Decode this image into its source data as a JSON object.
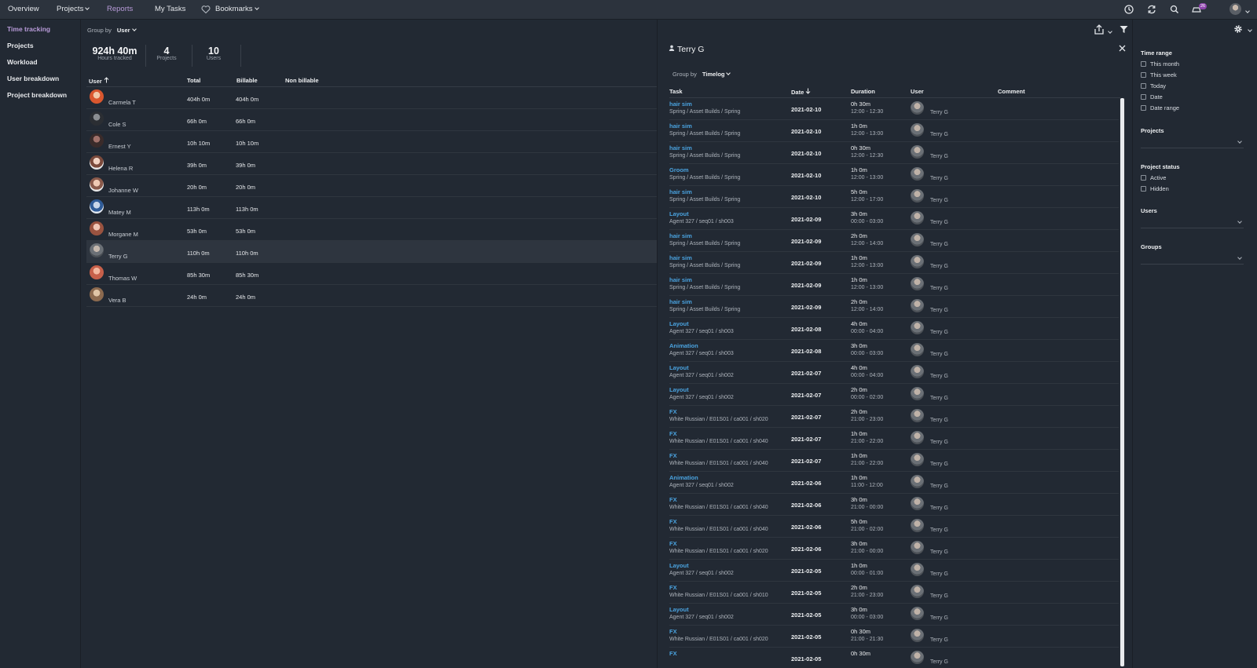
{
  "nav": {
    "overview": "Overview",
    "projects": "Projects",
    "reports": "Reports",
    "my_tasks": "My Tasks",
    "bookmarks": "Bookmarks",
    "notification_count": "26"
  },
  "sidebar": {
    "items": [
      "Time tracking",
      "Projects",
      "Workload",
      "User breakdown",
      "Project breakdown"
    ]
  },
  "report": {
    "group_by_label": "Group by",
    "group_by_value": "User",
    "stats": [
      {
        "value": "924h 40m",
        "label": "Hours tracked"
      },
      {
        "value": "4",
        "label": "Projects"
      },
      {
        "value": "10",
        "label": "Users"
      }
    ],
    "columns": [
      "User",
      "Total",
      "Billable",
      "Non billable"
    ],
    "rows": [
      {
        "name": "Carmela T",
        "total": "404h 0m",
        "billable": "404h 0m"
      },
      {
        "name": "Cole S",
        "total": "66h 0m",
        "billable": "66h 0m"
      },
      {
        "name": "Ernest Y",
        "total": "10h 10m",
        "billable": "10h 10m"
      },
      {
        "name": "Helena R",
        "total": "39h 0m",
        "billable": "39h 0m"
      },
      {
        "name": "Johanne W",
        "total": "20h 0m",
        "billable": "20h 0m"
      },
      {
        "name": "Matey M",
        "total": "113h 0m",
        "billable": "113h 0m"
      },
      {
        "name": "Morgane M",
        "total": "53h 0m",
        "billable": "53h 0m"
      },
      {
        "name": "Terry G",
        "total": "110h 0m",
        "billable": "110h 0m"
      },
      {
        "name": "Thomas W",
        "total": "85h 30m",
        "billable": "85h 30m"
      },
      {
        "name": "Vera B",
        "total": "24h 0m",
        "billable": "24h 0m"
      }
    ]
  },
  "detail": {
    "title": "Terry G",
    "group_by_label": "Group by",
    "group_by_value": "Timelog",
    "columns": [
      "Task",
      "Date",
      "Duration",
      "User",
      "Comment"
    ],
    "entries": [
      {
        "task": "hair sim",
        "path": "Spring / Asset Builds / Spring",
        "date": "2021-02-10",
        "duration": "0h 30m",
        "time": "12:00 - 12:30",
        "user": "Terry G"
      },
      {
        "task": "hair sim",
        "path": "Spring / Asset Builds / Spring",
        "date": "2021-02-10",
        "duration": "1h 0m",
        "time": "12:00 - 13:00",
        "user": "Terry G"
      },
      {
        "task": "hair sim",
        "path": "Spring / Asset Builds / Spring",
        "date": "2021-02-10",
        "duration": "0h 30m",
        "time": "12:00 - 12:30",
        "user": "Terry G"
      },
      {
        "task": "Groom",
        "path": "Spring / Asset Builds / Spring",
        "date": "2021-02-10",
        "duration": "1h 0m",
        "time": "12:00 - 13:00",
        "user": "Terry G"
      },
      {
        "task": "hair sim",
        "path": "Spring / Asset Builds / Spring",
        "date": "2021-02-10",
        "duration": "5h 0m",
        "time": "12:00 - 17:00",
        "user": "Terry G"
      },
      {
        "task": "Layout",
        "path": "Agent 327 / seq01 / sh003",
        "date": "2021-02-09",
        "duration": "3h 0m",
        "time": "00:00 - 03:00",
        "user": "Terry G"
      },
      {
        "task": "hair sim",
        "path": "Spring / Asset Builds / Spring",
        "date": "2021-02-09",
        "duration": "2h 0m",
        "time": "12:00 - 14:00",
        "user": "Terry G"
      },
      {
        "task": "hair sim",
        "path": "Spring / Asset Builds / Spring",
        "date": "2021-02-09",
        "duration": "1h 0m",
        "time": "12:00 - 13:00",
        "user": "Terry G"
      },
      {
        "task": "hair sim",
        "path": "Spring / Asset Builds / Spring",
        "date": "2021-02-09",
        "duration": "1h 0m",
        "time": "12:00 - 13:00",
        "user": "Terry G"
      },
      {
        "task": "hair sim",
        "path": "Spring / Asset Builds / Spring",
        "date": "2021-02-09",
        "duration": "2h 0m",
        "time": "12:00 - 14:00",
        "user": "Terry G"
      },
      {
        "task": "Layout",
        "path": "Agent 327 / seq01 / sh003",
        "date": "2021-02-08",
        "duration": "4h 0m",
        "time": "00:00 - 04:00",
        "user": "Terry G"
      },
      {
        "task": "Animation",
        "path": "Agent 327 / seq01 / sh003",
        "date": "2021-02-08",
        "duration": "3h 0m",
        "time": "00:00 - 03:00",
        "user": "Terry G"
      },
      {
        "task": "Layout",
        "path": "Agent 327 / seq01 / sh002",
        "date": "2021-02-07",
        "duration": "4h 0m",
        "time": "00:00 - 04:00",
        "user": "Terry G"
      },
      {
        "task": "Layout",
        "path": "Agent 327 / seq01 / sh002",
        "date": "2021-02-07",
        "duration": "2h 0m",
        "time": "00:00 - 02:00",
        "user": "Terry G"
      },
      {
        "task": "FX",
        "path": "White Russian / E01S01 / ca001 / sh020",
        "date": "2021-02-07",
        "duration": "2h 0m",
        "time": "21:00 - 23:00",
        "user": "Terry G"
      },
      {
        "task": "FX",
        "path": "White Russian / E01S01 / ca001 / sh040",
        "date": "2021-02-07",
        "duration": "1h 0m",
        "time": "21:00 - 22:00",
        "user": "Terry G"
      },
      {
        "task": "FX",
        "path": "White Russian / E01S01 / ca001 / sh040",
        "date": "2021-02-07",
        "duration": "1h 0m",
        "time": "21:00 - 22:00",
        "user": "Terry G"
      },
      {
        "task": "Animation",
        "path": "Agent 327 / seq01 / sh002",
        "date": "2021-02-06",
        "duration": "1h 0m",
        "time": "11:00 - 12:00",
        "user": "Terry G"
      },
      {
        "task": "FX",
        "path": "White Russian / E01S01 / ca001 / sh040",
        "date": "2021-02-06",
        "duration": "3h 0m",
        "time": "21:00 - 00:00",
        "user": "Terry G"
      },
      {
        "task": "FX",
        "path": "White Russian / E01S01 / ca001 / sh040",
        "date": "2021-02-06",
        "duration": "5h 0m",
        "time": "21:00 - 02:00",
        "user": "Terry G"
      },
      {
        "task": "FX",
        "path": "White Russian / E01S01 / ca001 / sh020",
        "date": "2021-02-06",
        "duration": "3h 0m",
        "time": "21:00 - 00:00",
        "user": "Terry G"
      },
      {
        "task": "Layout",
        "path": "Agent 327 / seq01 / sh002",
        "date": "2021-02-05",
        "duration": "1h 0m",
        "time": "00:00 - 01:00",
        "user": "Terry G"
      },
      {
        "task": "FX",
        "path": "White Russian / E01S01 / ca001 / sh010",
        "date": "2021-02-05",
        "duration": "2h 0m",
        "time": "21:00 - 23:00",
        "user": "Terry G"
      },
      {
        "task": "Layout",
        "path": "Agent 327 / seq01 / sh002",
        "date": "2021-02-05",
        "duration": "3h 0m",
        "time": "00:00 - 03:00",
        "user": "Terry G"
      },
      {
        "task": "FX",
        "path": "White Russian / E01S01 / ca001 / sh020",
        "date": "2021-02-05",
        "duration": "0h 30m",
        "time": "21:00 - 21:30",
        "user": "Terry G"
      },
      {
        "task": "FX",
        "path": "",
        "date": "2021-02-05",
        "duration": "0h 30m",
        "time": "",
        "user": "Terry G"
      }
    ]
  },
  "filters": {
    "time_range_title": "Time range",
    "time_range_options": [
      "This month",
      "This week",
      "Today",
      "Date",
      "Date range"
    ],
    "projects_title": "Projects",
    "project_status_title": "Project status",
    "project_status_options": [
      "Active",
      "Hidden"
    ],
    "users_title": "Users",
    "groups_title": "Groups"
  }
}
